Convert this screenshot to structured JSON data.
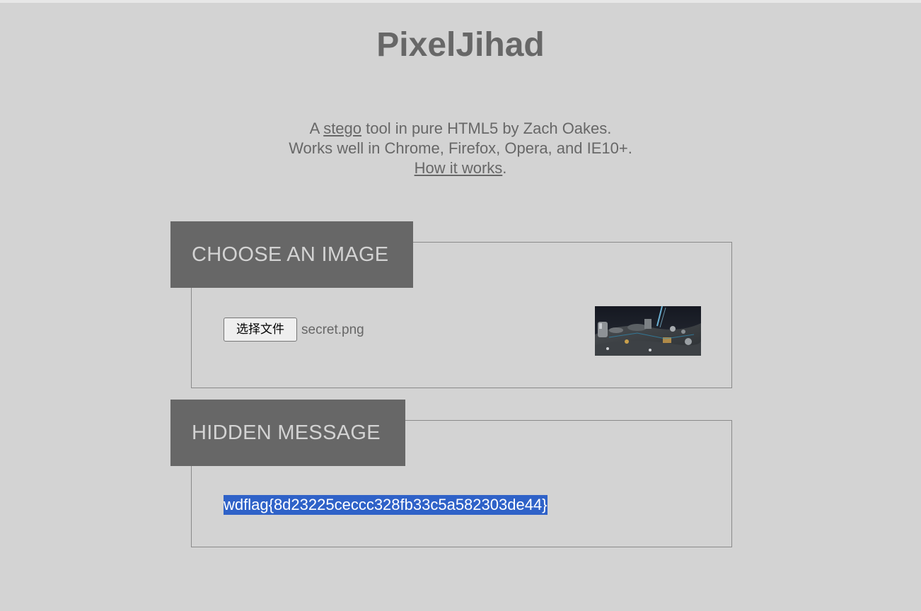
{
  "header": {
    "title": "PixelJihad"
  },
  "intro": {
    "line1_prefix": "A ",
    "line1_link": "stego",
    "line1_suffix": " tool in pure HTML5 by Zach Oakes.",
    "line2": "Works well in Chrome, Firefox, Opera, and IE10+.",
    "line3_link": "How it works",
    "line3_suffix": "."
  },
  "image_panel": {
    "heading": "CHOOSE AN IMAGE",
    "file_button_label": "选择文件",
    "file_name": "secret.png",
    "thumbnail_icon": "space-scene-thumbnail"
  },
  "message_panel": {
    "heading": "HIDDEN MESSAGE",
    "message": "wdflag{8d23225ceccc328fb33c5a582303de44}"
  },
  "colors": {
    "background": "#d3d3d3",
    "header_box": "#676767",
    "text": "#676767",
    "selection": "#2f62c8"
  }
}
